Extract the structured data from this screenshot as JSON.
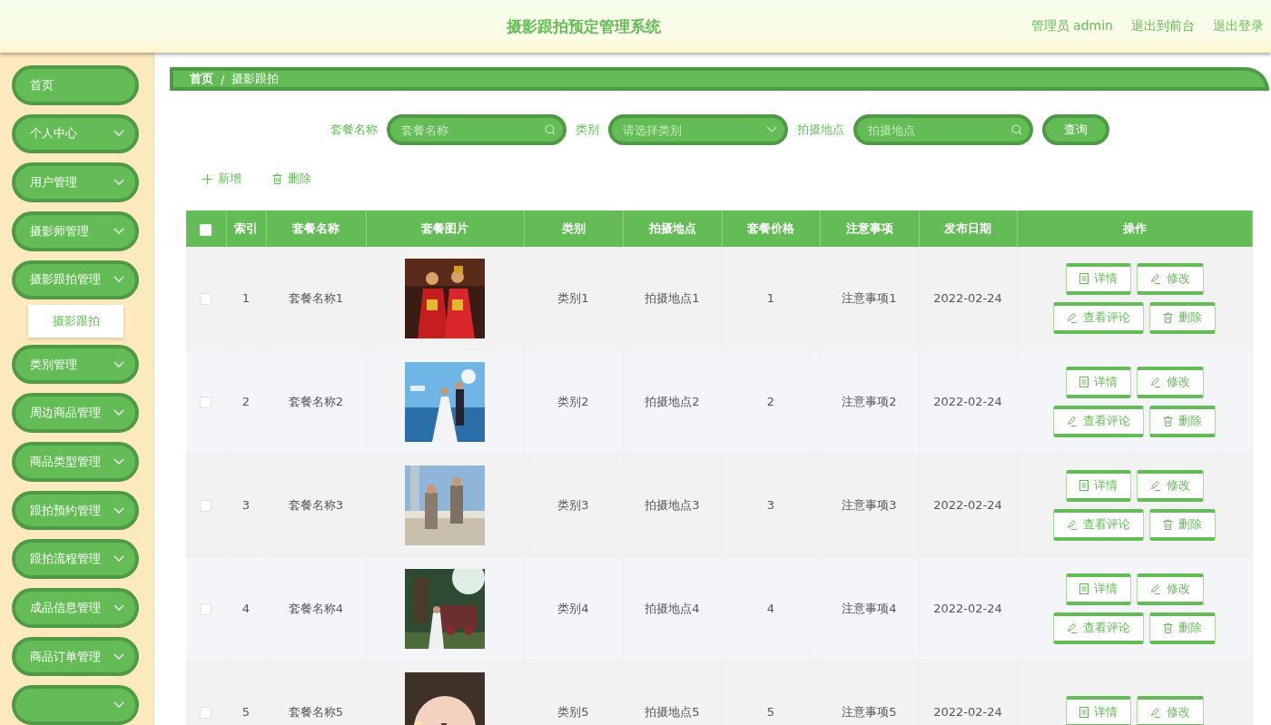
{
  "header": {
    "title": "摄影跟拍预定管理系统",
    "links": [
      "管理员 admin",
      "退出到前台",
      "退出登录"
    ]
  },
  "sidebar": {
    "items": [
      {
        "label": "首页",
        "kind": "link"
      },
      {
        "label": "个人中心",
        "kind": "menu"
      },
      {
        "label": "用户管理",
        "kind": "menu"
      },
      {
        "label": "摄影师管理",
        "kind": "menu"
      },
      {
        "label": "摄影跟拍管理",
        "kind": "menu",
        "children": [
          {
            "label": "摄影跟拍"
          }
        ]
      },
      {
        "label": "类别管理",
        "kind": "menu"
      },
      {
        "label": "周边商品管理",
        "kind": "menu"
      },
      {
        "label": "商品类型管理",
        "kind": "menu"
      },
      {
        "label": "跟拍预约管理",
        "kind": "menu"
      },
      {
        "label": "跟拍流程管理",
        "kind": "menu"
      },
      {
        "label": "成品信息管理",
        "kind": "menu"
      },
      {
        "label": "商品订单管理",
        "kind": "menu"
      },
      {
        "kind": "menu"
      }
    ]
  },
  "breadcrumb": {
    "items": [
      "首页",
      "摄影跟拍"
    ],
    "separator": "/"
  },
  "search": {
    "fields": [
      {
        "label": "套餐名称",
        "placeholder": "套餐名称",
        "kind": "text"
      },
      {
        "label": "类别",
        "placeholder": "请选择类别",
        "kind": "select"
      },
      {
        "label": "拍摄地点",
        "placeholder": "拍摄地点",
        "kind": "text"
      }
    ],
    "button": "查询"
  },
  "toolbar": [
    {
      "label": "新增",
      "kind": "add"
    },
    {
      "label": "删除",
      "kind": "delete"
    }
  ],
  "table": {
    "header_checked": false,
    "columns": [
      "索引",
      "套餐名称",
      "套餐图片",
      "类别",
      "拍摄地点",
      "套餐价格",
      "注意事项",
      "发布日期",
      "操作"
    ],
    "rows": [
      {
        "checked": false,
        "cells": [
          "1",
          "套餐名称1",
          {
            "kind": "picture"
          },
          "类别1",
          "拍摄地点1",
          "1",
          "注意事项1",
          "2022-02-24"
        ],
        "actions": [
          "详情",
          "修改",
          "查看评论",
          "删除"
        ]
      },
      {
        "checked": false,
        "cells": [
          "2",
          "套餐名称2",
          {
            "kind": "picture"
          },
          "类别2",
          "拍摄地点2",
          "2",
          "注意事项2",
          "2022-02-24"
        ],
        "actions": [
          "详情",
          "修改",
          "查看评论",
          "删除"
        ]
      },
      {
        "checked": false,
        "cells": [
          "3",
          "套餐名称3",
          {
            "kind": "picture"
          },
          "类别3",
          "拍摄地点3",
          "3",
          "注意事项3",
          "2022-02-24"
        ],
        "actions": [
          "详情",
          "修改",
          "查看评论",
          "删除"
        ]
      },
      {
        "checked": false,
        "cells": [
          "4",
          "套餐名称4",
          {
            "kind": "picture"
          },
          "类别4",
          "拍摄地点4",
          "4",
          "注意事项4",
          "2022-02-24"
        ],
        "actions": [
          "详情",
          "修改",
          "查看评论",
          "删除"
        ]
      },
      {
        "checked": false,
        "cells": [
          "5",
          "套餐名称5",
          {
            "kind": "picture"
          },
          "类别5",
          "拍摄地点5",
          "5",
          "注意事项5",
          "2022-02-24"
        ],
        "actions": [
          "详情",
          "修改"
        ]
      }
    ]
  }
}
